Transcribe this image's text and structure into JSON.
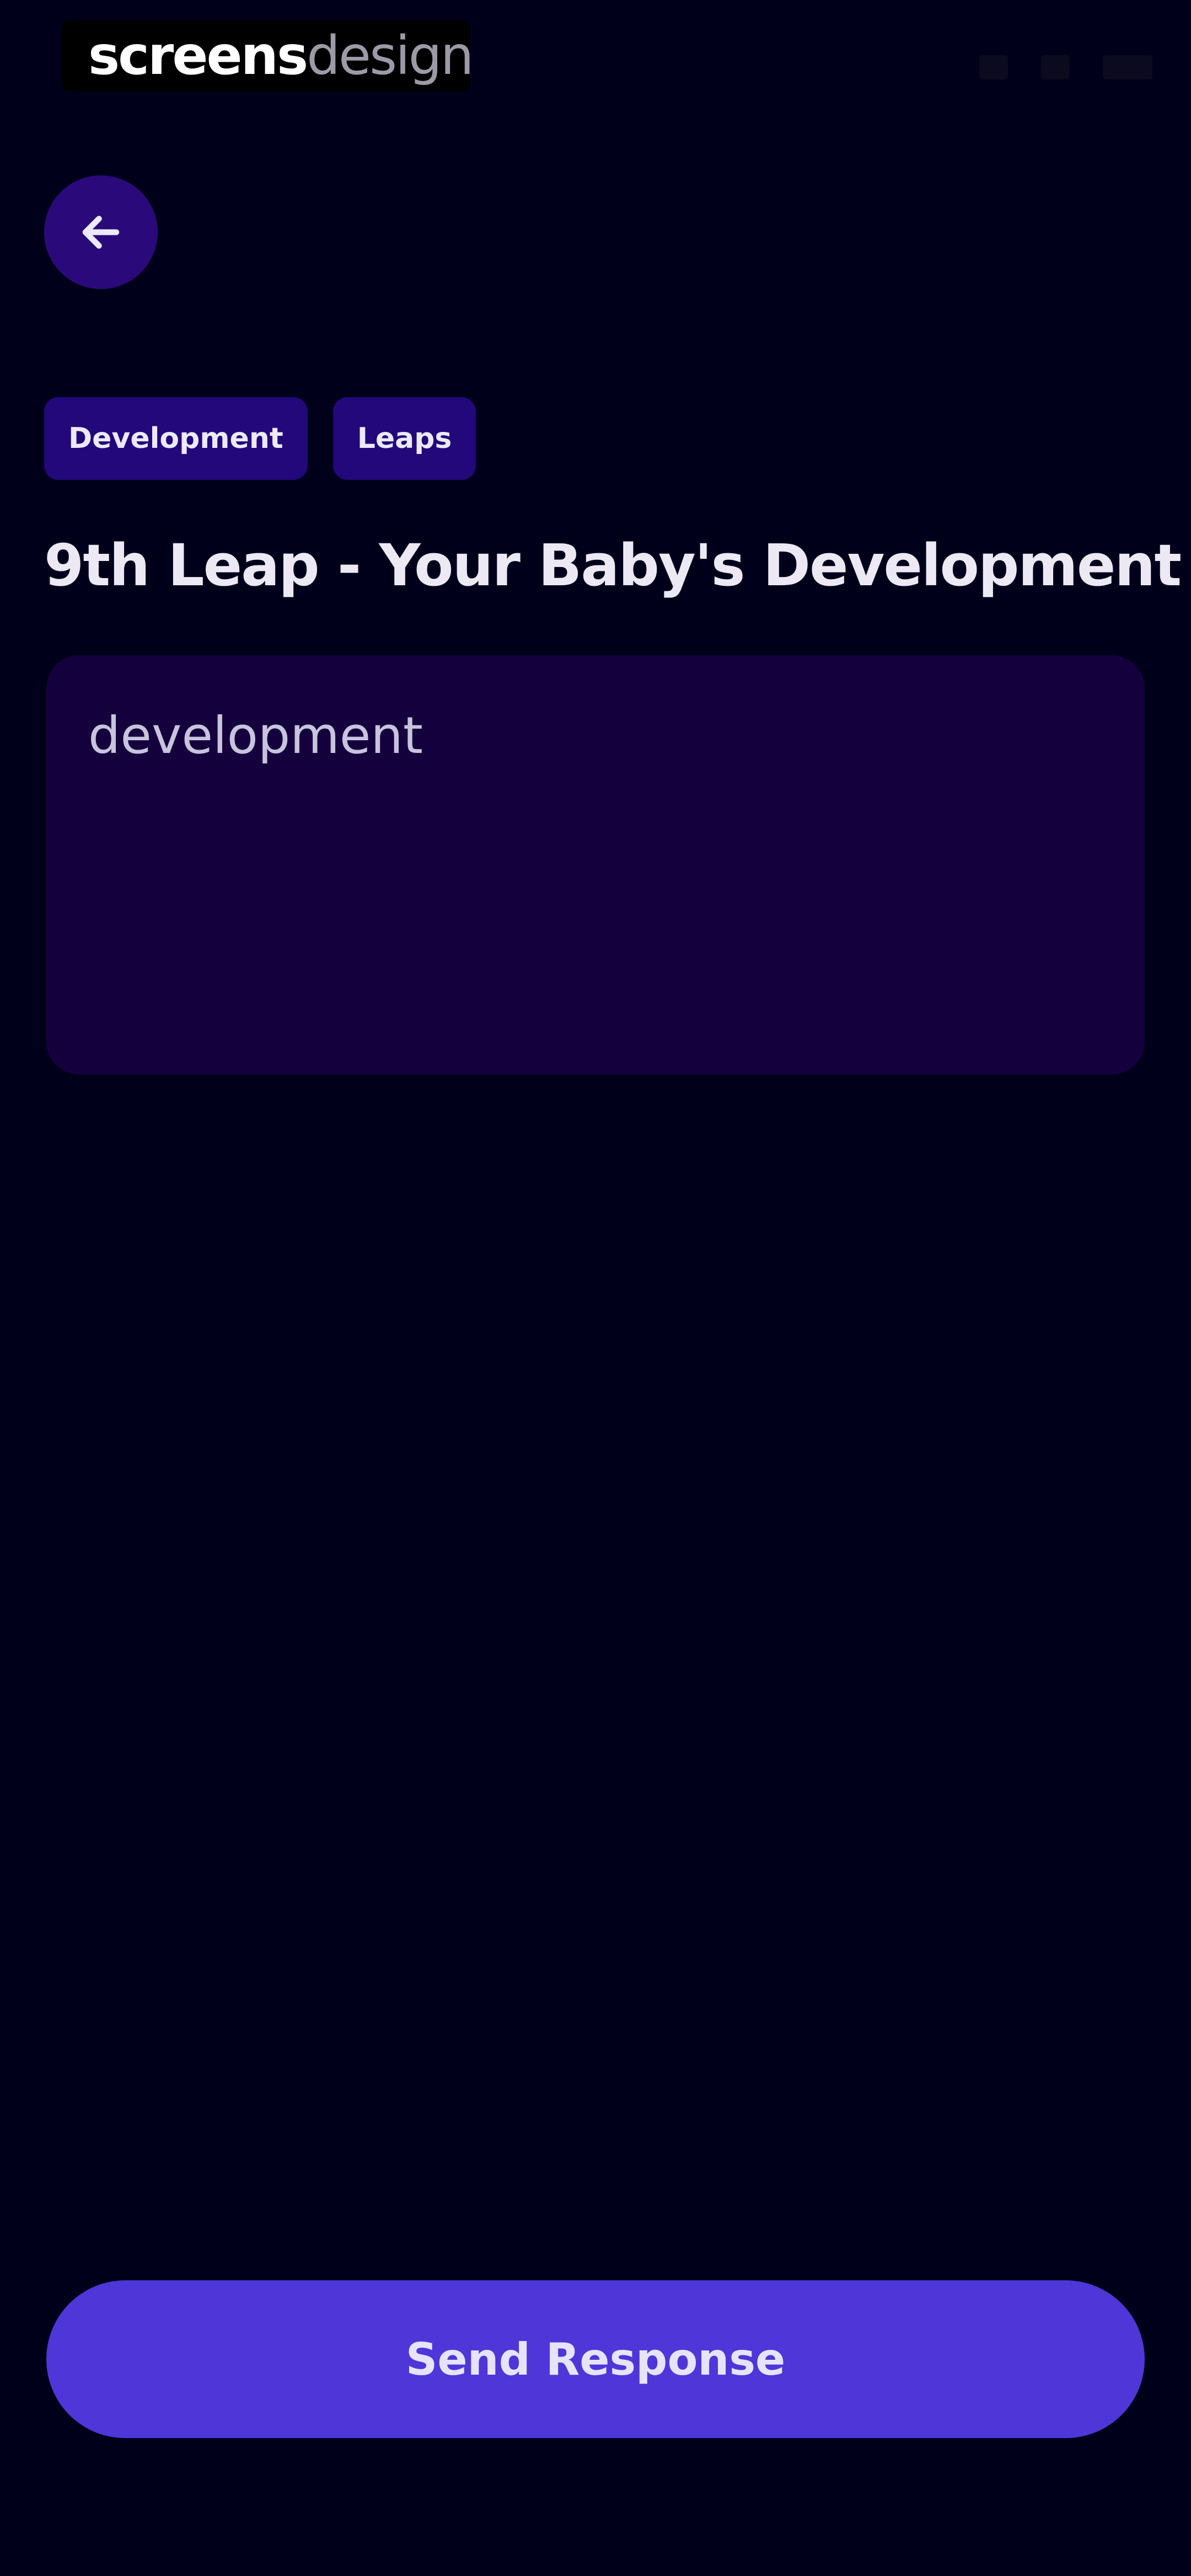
{
  "brand": {
    "bold": "screens",
    "light": "design"
  },
  "status_bar": {
    "icons": [
      "wifi-icon",
      "signal-icon",
      "battery-icon"
    ]
  },
  "back_button": {
    "icon": "arrow-left-icon"
  },
  "tags": [
    {
      "label": "Development"
    },
    {
      "label": "Leaps"
    }
  ],
  "title": "9th Leap - Your Baby's Development",
  "response_box": {
    "placeholder": "development"
  },
  "send_button": {
    "label": "Send Response"
  },
  "colors": {
    "background": "#01001a",
    "accent": "#4e36d9",
    "tag_bg": "#22087a",
    "input_bg": "#15003e",
    "back_button_bg": "#2a0a7a"
  }
}
